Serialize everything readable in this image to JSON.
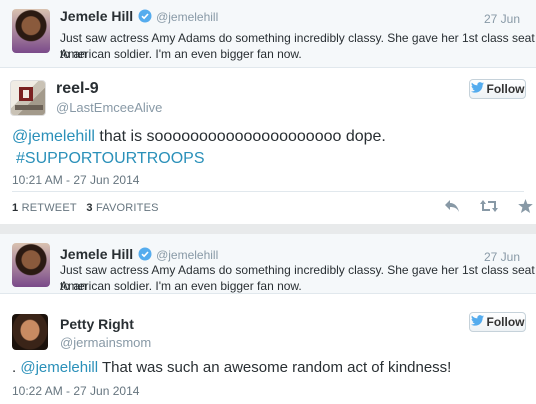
{
  "tweet1": {
    "context": {
      "name": "Jemele Hill",
      "handle": "@jemelehill",
      "date": "27 Jun",
      "text_line1": "Just saw actress Amy Adams do something incredibly classy. She gave her 1st class seat to an",
      "text_line2": "American soldier. I'm an even bigger fan now."
    },
    "reply": {
      "name": "reel-9",
      "handle": "@LastEmceeAlive",
      "follow_label": "Follow",
      "mention": "@jemelehill",
      "body": " that is sooooooooooooooooooooo dope.",
      "hashtag": "#SUPPORTOURTROOPS",
      "timestamp": "10:21 AM - 27 Jun 2014",
      "retweet_count": "1",
      "retweet_label": "RETWEET",
      "favorite_count": "3",
      "favorite_label": "FAVORITES"
    }
  },
  "tweet2": {
    "context": {
      "name": "Jemele Hill",
      "handle": "@jemelehill",
      "date": "27 Jun",
      "text_line1": "Just saw actress Amy Adams do something incredibly classy. She gave her 1st class seat to an",
      "text_line2": "American soldier. I'm an even bigger fan now."
    },
    "reply": {
      "name": "Petty Right",
      "handle": "@jermainsmom",
      "follow_label": "Follow",
      "prefix": ". ",
      "mention": "@jemelehill",
      "body": " That was such an awesome random act of kindness!",
      "timestamp": "10:22 AM - 27 Jun 2014"
    }
  },
  "colors": {
    "link": "#2a90b9",
    "bird": "#55acee",
    "muted": "#8899a6"
  }
}
